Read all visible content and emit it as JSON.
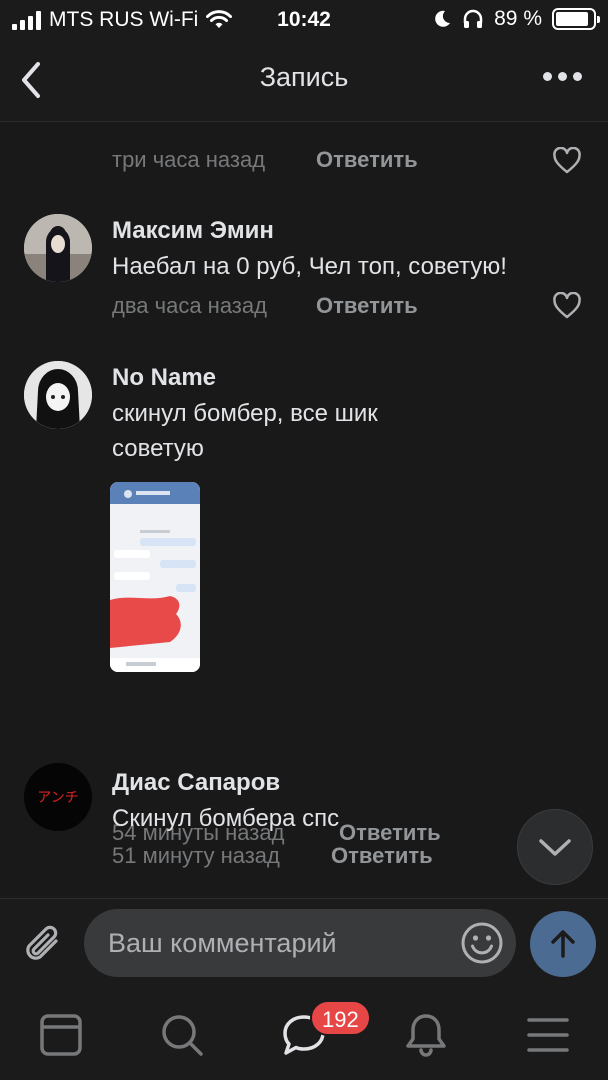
{
  "status_bar": {
    "carrier": "MTS RUS Wi-Fi",
    "time": "10:42",
    "battery": "89 %",
    "battery_level": 0.89
  },
  "header": {
    "title": "Запись"
  },
  "comments": [
    {
      "time": "три часа назад",
      "reply": "Ответить"
    },
    {
      "name": "Максим Эмин",
      "text": "Наебал на 0 руб, Чел топ, советую!",
      "time": "два часа назад",
      "reply": "Ответить"
    },
    {
      "name": "No Name",
      "text": "скинул бомбер, все шик советую",
      "time": "54 минуты назад",
      "reply": "Ответить"
    },
    {
      "name": "Диас Сапаров",
      "avatar_text": "アンチ",
      "text": "Скинул бомбера спс",
      "time": "51 минуту назад",
      "reply": "Ответить"
    }
  ],
  "composer": {
    "placeholder": "Ваш комментарий"
  },
  "tabbar": {
    "messages_badge": "192",
    "items": [
      "feed-icon",
      "search-icon",
      "messages-icon",
      "notifications-icon",
      "menu-icon"
    ]
  },
  "colors": {
    "background": "#191919",
    "accent": "#4c6b93",
    "badge": "#e64646"
  }
}
